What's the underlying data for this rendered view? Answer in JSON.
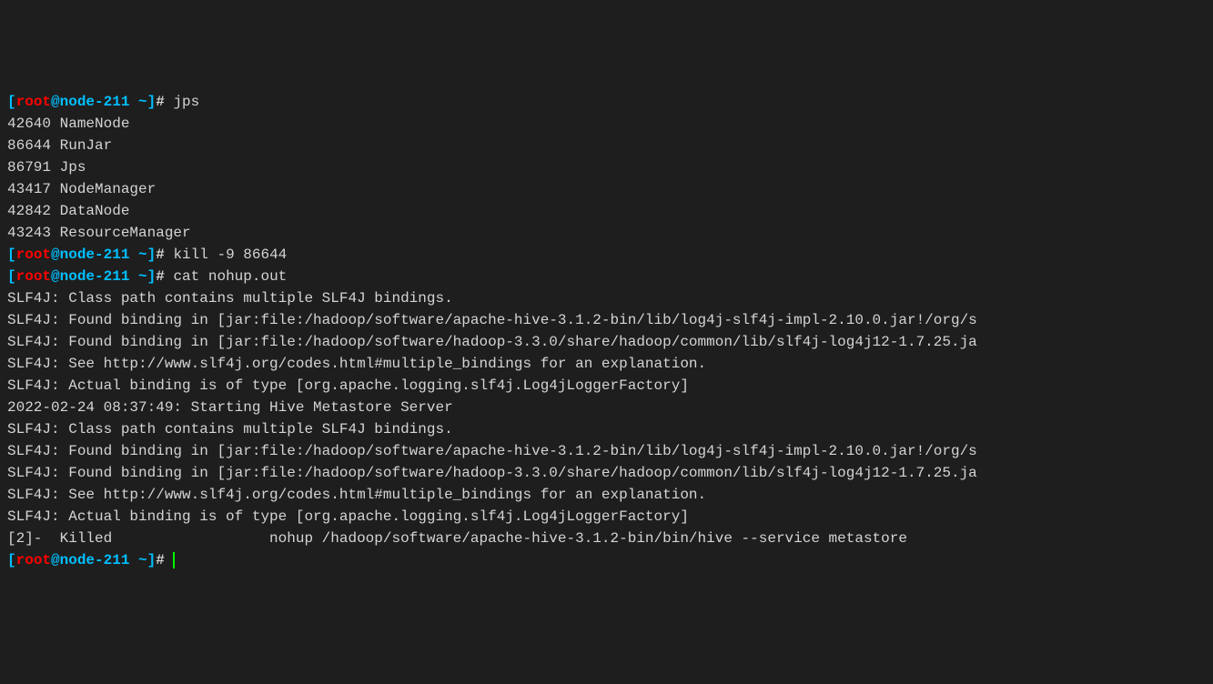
{
  "prompt": {
    "open_bracket": "[",
    "user": "root",
    "at": "@",
    "host": "node-211",
    "path": " ~",
    "close_bracket": "]",
    "hash": "# "
  },
  "lines": [
    {
      "type": "prompt",
      "cmd": "jps"
    },
    {
      "type": "output",
      "text": "42640 NameNode"
    },
    {
      "type": "output",
      "text": "86644 RunJar"
    },
    {
      "type": "output",
      "text": "86791 Jps"
    },
    {
      "type": "output",
      "text": "43417 NodeManager"
    },
    {
      "type": "output",
      "text": "42842 DataNode"
    },
    {
      "type": "output",
      "text": "43243 ResourceManager"
    },
    {
      "type": "prompt",
      "cmd": "kill -9 86644"
    },
    {
      "type": "prompt",
      "cmd": "cat nohup.out"
    },
    {
      "type": "output",
      "text": "SLF4J: Class path contains multiple SLF4J bindings."
    },
    {
      "type": "output",
      "text": "SLF4J: Found binding in [jar:file:/hadoop/software/apache-hive-3.1.2-bin/lib/log4j-slf4j-impl-2.10.0.jar!/org/s"
    },
    {
      "type": "output",
      "text": "SLF4J: Found binding in [jar:file:/hadoop/software/hadoop-3.3.0/share/hadoop/common/lib/slf4j-log4j12-1.7.25.ja"
    },
    {
      "type": "output",
      "text": "SLF4J: See http://www.slf4j.org/codes.html#multiple_bindings for an explanation."
    },
    {
      "type": "output",
      "text": "SLF4J: Actual binding is of type [org.apache.logging.slf4j.Log4jLoggerFactory]"
    },
    {
      "type": "output",
      "text": "2022-02-24 08:37:49: Starting Hive Metastore Server"
    },
    {
      "type": "output",
      "text": "SLF4J: Class path contains multiple SLF4J bindings."
    },
    {
      "type": "output",
      "text": "SLF4J: Found binding in [jar:file:/hadoop/software/apache-hive-3.1.2-bin/lib/log4j-slf4j-impl-2.10.0.jar!/org/s"
    },
    {
      "type": "output",
      "text": "SLF4J: Found binding in [jar:file:/hadoop/software/hadoop-3.3.0/share/hadoop/common/lib/slf4j-log4j12-1.7.25.ja"
    },
    {
      "type": "output",
      "text": "SLF4J: See http://www.slf4j.org/codes.html#multiple_bindings for an explanation."
    },
    {
      "type": "output",
      "text": "SLF4J: Actual binding is of type [org.apache.logging.slf4j.Log4jLoggerFactory]"
    },
    {
      "type": "output",
      "text": "[2]-  Killed                  nohup /hadoop/software/apache-hive-3.1.2-bin/bin/hive --service metastore"
    },
    {
      "type": "prompt",
      "cmd": "",
      "cursor": true
    }
  ]
}
